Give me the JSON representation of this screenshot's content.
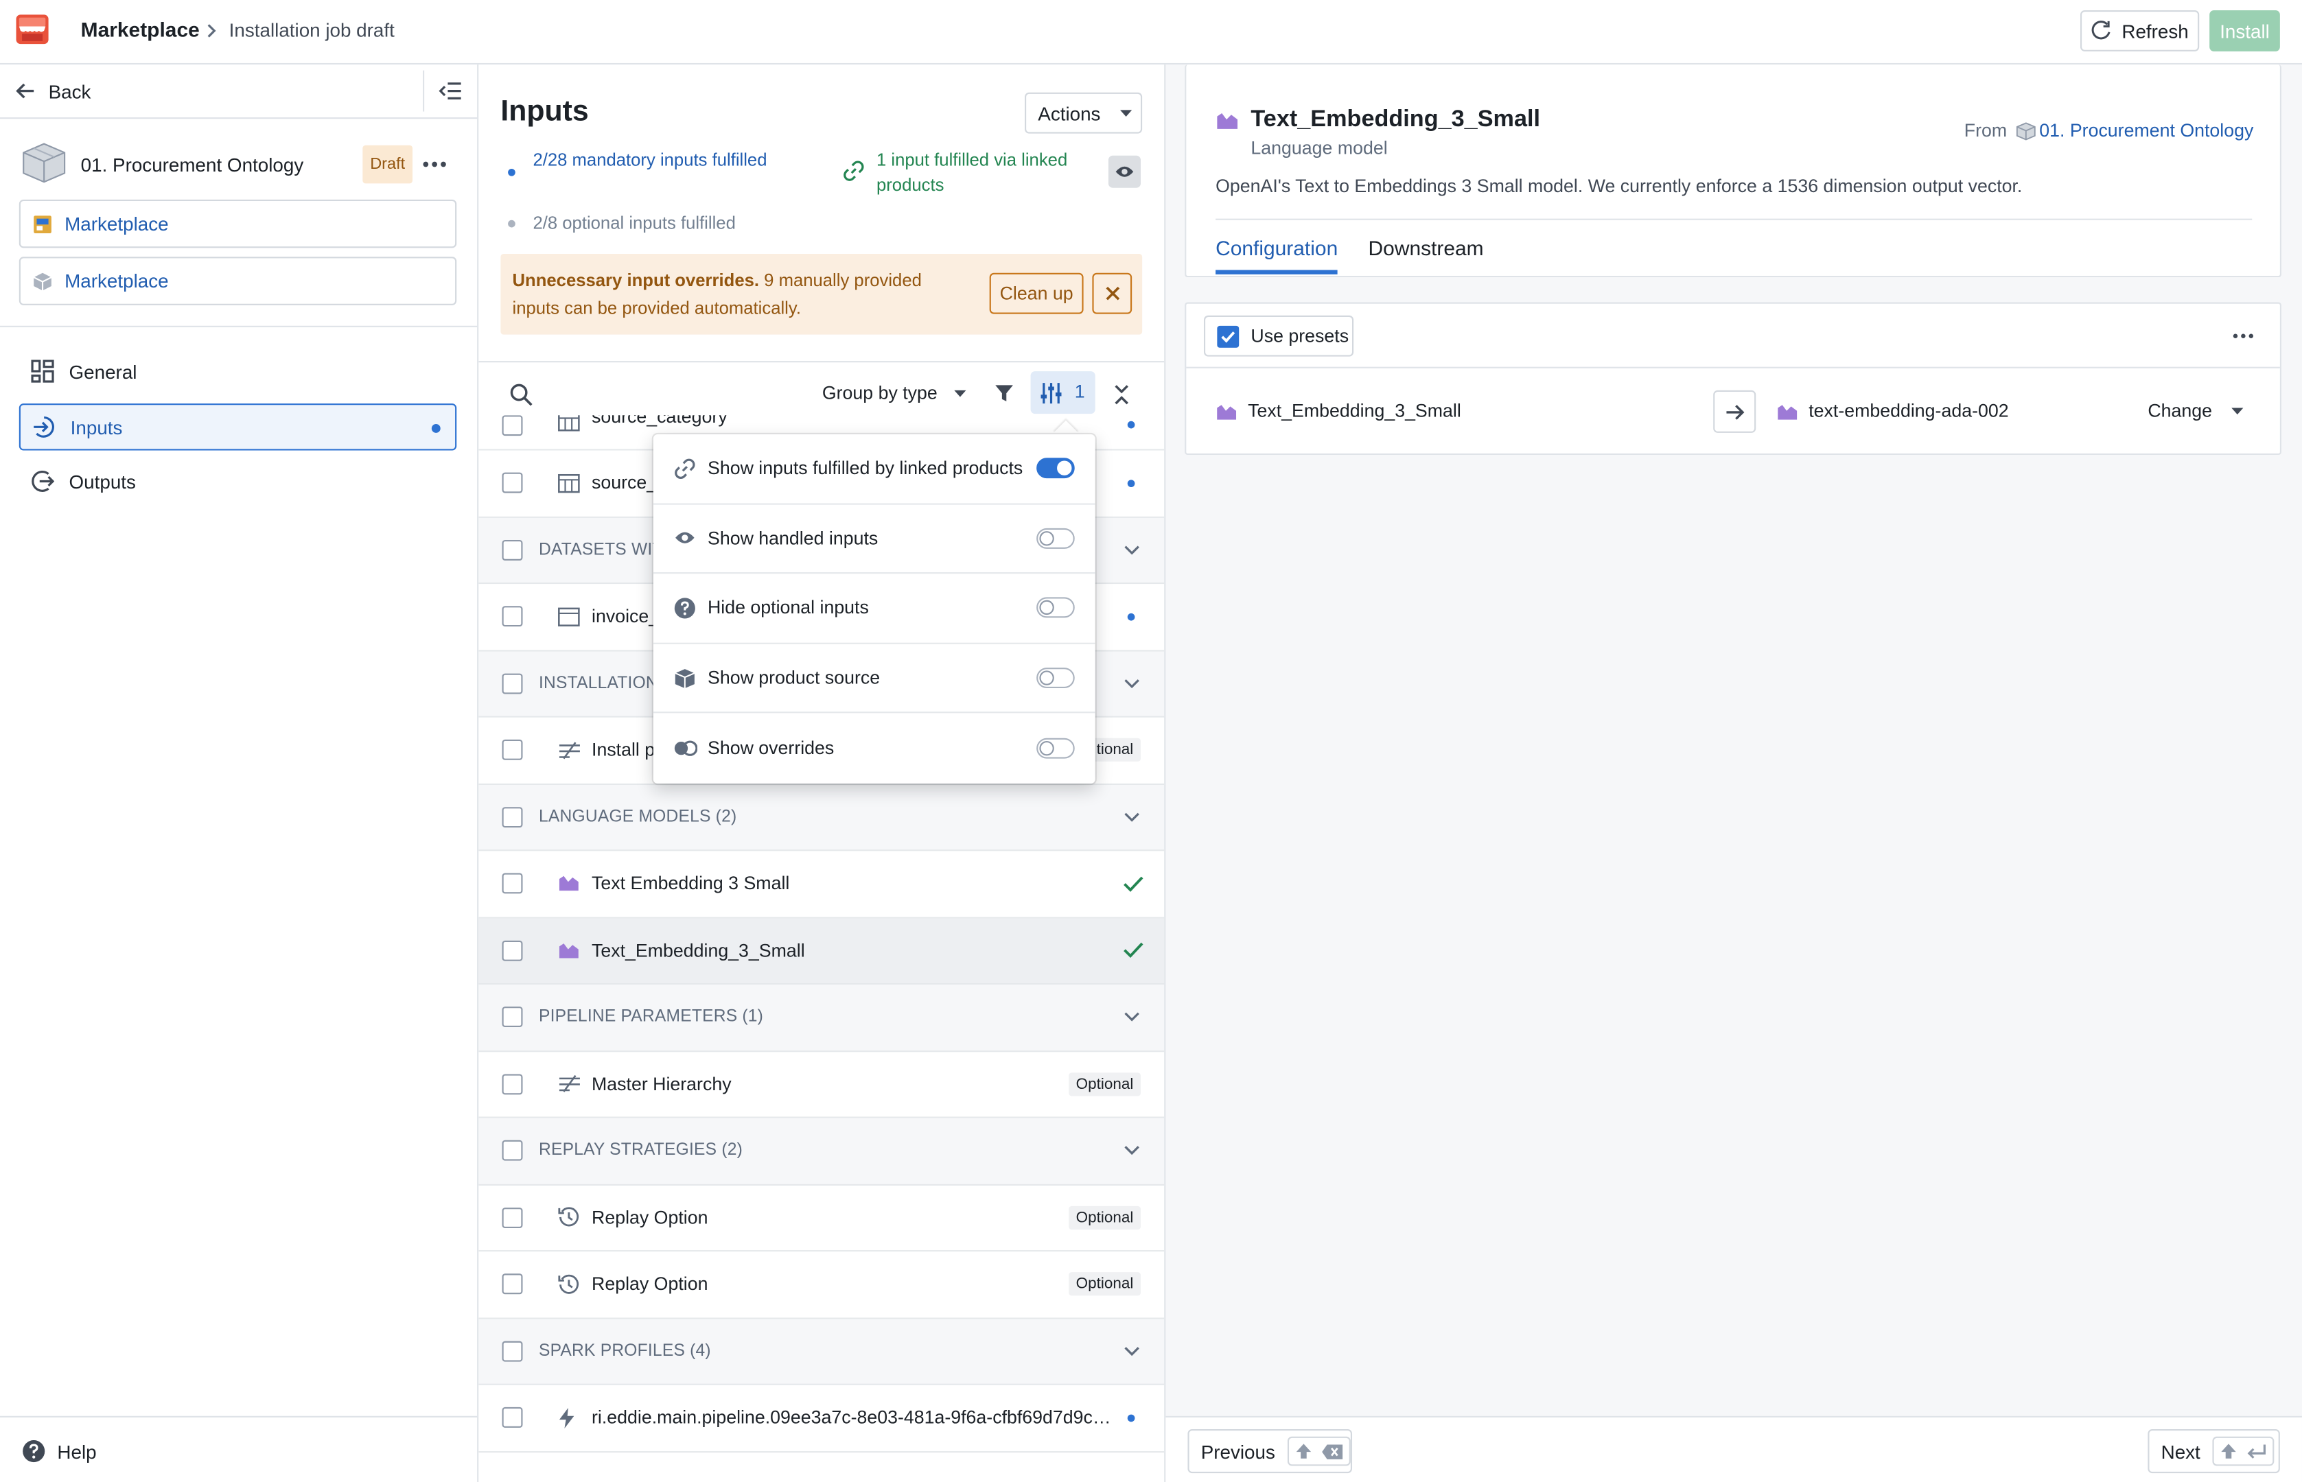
{
  "header": {
    "app_title": "Marketplace",
    "breadcrumb_current": "Installation job draft",
    "refresh_label": "Refresh",
    "install_label": "Install",
    "brand_color": "#d9412b"
  },
  "sidebar": {
    "back_label": "Back",
    "product_name": "01. Procurement Ontology",
    "draft_badge": "Draft",
    "marketplace_links": [
      "Marketplace",
      "Marketplace"
    ],
    "nav": {
      "general": "General",
      "inputs": "Inputs",
      "outputs": "Outputs"
    },
    "help_label": "Help"
  },
  "inputs_panel": {
    "title": "Inputs",
    "actions_label": "Actions",
    "mandatory_status": "2/28 mandatory inputs fulfilled",
    "linked_status": "1 input fulfilled via linked products",
    "optional_status": "2/8 optional inputs fulfilled",
    "warning_bold": "Unnecessary input overrides.",
    "warning_text": " 9 manually provided inputs can be provided automatically.",
    "cleanup_label": "Clean up",
    "group_by_label": "Group by type",
    "settings_count": "1",
    "rows": {
      "source_category": "source_category",
      "source_2": "source_",
      "datasets_group": "DATASETS WIT",
      "invoice": "invoice_",
      "installation_group": "INSTALLATION",
      "install_item": "Install p",
      "install_tag": "tional",
      "language_group": "LANGUAGE MODELS (2)",
      "lm1": "Text Embedding 3 Small",
      "lm2": "Text_Embedding_3_Small",
      "pipeline_group": "PIPELINE PARAMETERS (1)",
      "master": "Master Hierarchy",
      "replay_group": "REPLAY STRATEGIES (2)",
      "replay1": "Replay Option",
      "replay2": "Replay Option",
      "spark_group": "SPARK PROFILES (4)",
      "spark1": "ri.eddie.main.pipeline.09ee3a7c-8e03-481a-9f6a-cfbf69d7d9cd..."
    },
    "optional_tag": "Optional"
  },
  "view_menu": {
    "items": [
      {
        "label": "Show inputs fulfilled by linked products",
        "on": true
      },
      {
        "label": "Show handled inputs",
        "on": false
      },
      {
        "label": "Hide optional inputs",
        "on": false
      },
      {
        "label": "Show product source",
        "on": false
      },
      {
        "label": "Show overrides",
        "on": false
      }
    ]
  },
  "detail": {
    "title": "Text_Embedding_3_Small",
    "subtitle": "Language model",
    "from_label": "From",
    "from_link": "01. Procurement Ontology",
    "description": "OpenAI's Text to Embeddings 3 Small model. We currently enforce a 1536 dimension output vector.",
    "tabs": [
      "Configuration",
      "Downstream"
    ],
    "use_presets_label": "Use presets",
    "mapping_source": "Text_Embedding_3_Small",
    "mapping_target": "text-embedding-ada-002",
    "change_label": "Change",
    "accent_color": "#2d72d2",
    "model_icon_color": "#9d7ad6"
  },
  "footer": {
    "previous_label": "Previous",
    "next_label": "Next"
  }
}
